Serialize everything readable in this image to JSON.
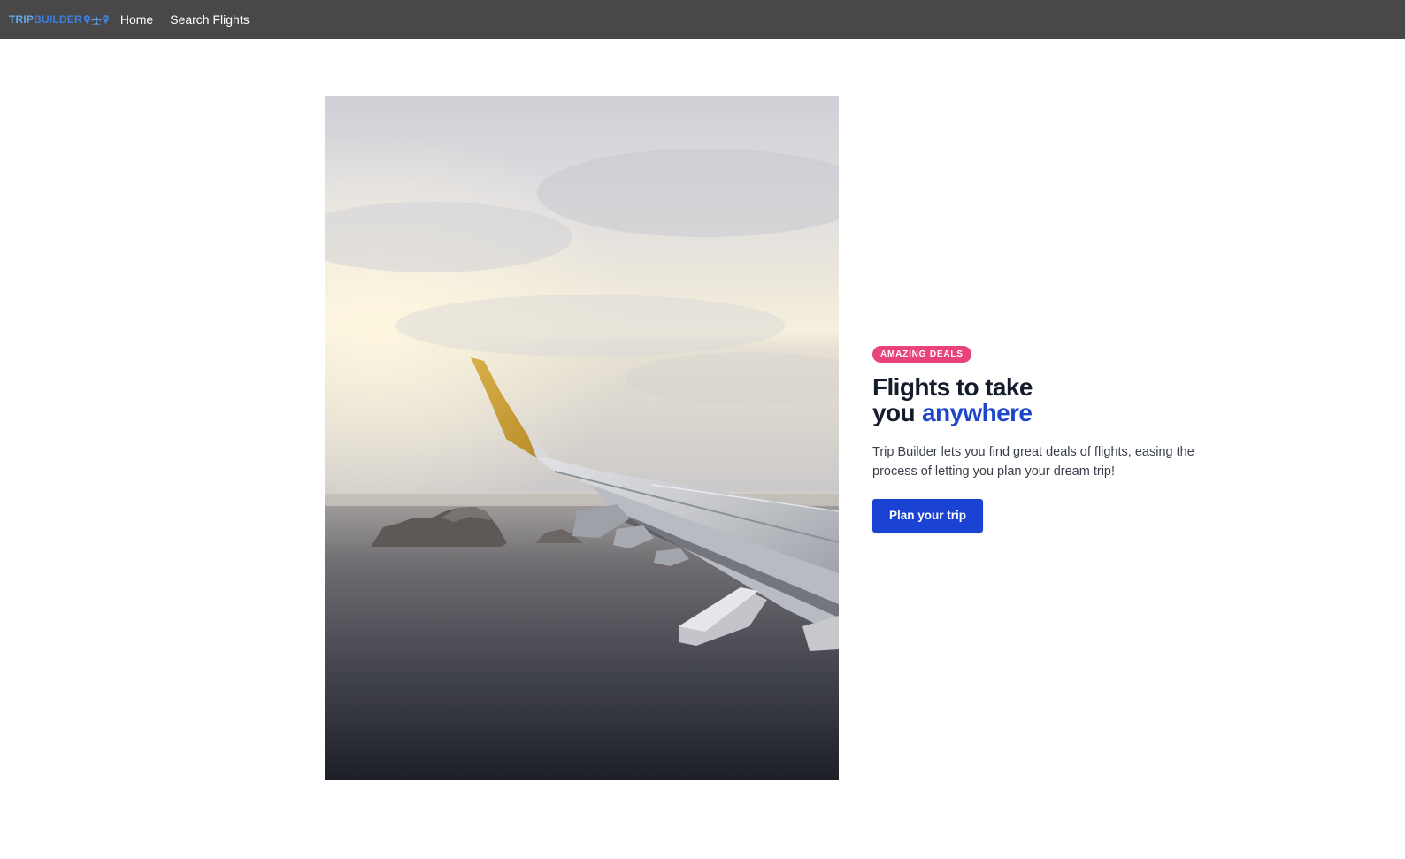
{
  "nav": {
    "brand_part1": "TRIP",
    "brand_part2": "BUILDER",
    "brand_icons": [
      "map-pin-icon",
      "airplane-icon",
      "map-pin-icon"
    ],
    "links": [
      {
        "label": "Home"
      },
      {
        "label": "Search Flights"
      }
    ]
  },
  "hero": {
    "image_subject": "airplane-wing-over-sea-photo",
    "badge": "AMAZING DEALS",
    "title_line1": "Flights to take",
    "title_line2": "you",
    "title_accent": "anywhere",
    "description": "Trip Builder lets you find great deals of flights, easing the process of letting you plan your dream trip!",
    "cta_label": "Plan your trip"
  },
  "colors": {
    "navbar_bg": "#484848",
    "brand_light": "#64a8ea",
    "brand_dark": "#3f7fe0",
    "badge_bg": "#e8437d",
    "accent": "#1e46c8",
    "cta_bg": "#1a43d3",
    "heading": "#151c2c"
  }
}
